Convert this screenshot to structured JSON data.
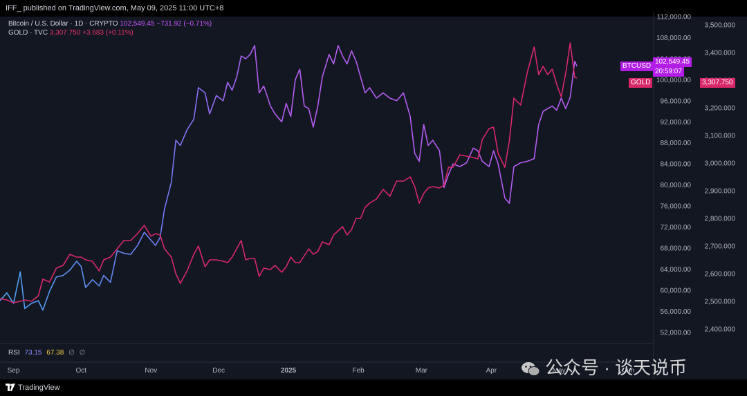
{
  "header": {
    "published": "IFF_ published on TradingView.com, May 09, 2025 11:00 UTC+8"
  },
  "legend": {
    "btc": {
      "name": "Bitcoin / U.S. Dollar · 1D · CRYPTO",
      "price": "102,549.45",
      "change": "−731.92 (−0.71%)"
    },
    "gold": {
      "name": "GOLD · TVC",
      "price": "3,307.750",
      "change": "+3.683 (+0.11%)"
    }
  },
  "tags": {
    "btc_label": "BTCUSD",
    "btc_price": "102,549.45",
    "btc_time": "20:59:07",
    "gold_label": "GOLD",
    "gold_price": "3,307.750"
  },
  "rsi": {
    "label": "RSI",
    "v1": "73.15",
    "v2": "67.38",
    "g1": "∅",
    "g2": "∅"
  },
  "footer": {
    "brand": "TradingView"
  },
  "watermark": {
    "text": "公众号 · 谈天说币"
  },
  "colors": {
    "btc": "#b45cf0",
    "btc_early": "#4aa3f0",
    "gold": "#d8286a",
    "bg": "#131722"
  },
  "chart_data": {
    "type": "line",
    "title": "",
    "x_ticks": [
      "Sep",
      "Oct",
      "Nov",
      "Dec",
      "2025",
      "Feb",
      "Mar",
      "Apr",
      "May",
      "Jun"
    ],
    "left_axis": {
      "series": "BTCUSD",
      "ticks": [
        "112,000.00",
        "108,000.00",
        "104,000.00",
        "100,000.00",
        "96,000.00",
        "92,000.00",
        "88,000.00",
        "84,000.00",
        "80,000.00",
        "76,000.00",
        "72,000.00",
        "68,000.00",
        "64,000.00",
        "60,000.00",
        "56,000.00",
        "52,000.00"
      ],
      "ylim": [
        50000,
        112000
      ]
    },
    "right_axis": {
      "series": "GOLD",
      "ticks": [
        "3,500.000",
        "3,400.000",
        "3,300.000",
        "3,200.000",
        "3,100.000",
        "3,000.000",
        "2,900.000",
        "2,800.000",
        "2,700.000",
        "2,600.000",
        "2,500.000",
        "2,400.000"
      ],
      "ylim": [
        2350,
        3530
      ]
    },
    "series": [
      {
        "name": "BTCUSD",
        "axis": "left",
        "points": [
          [
            "Aug 26",
            58000
          ],
          [
            "Aug 29",
            59500
          ],
          [
            "Sep 1",
            57500
          ],
          [
            "Sep 4",
            63500
          ],
          [
            "Sep 6",
            56500
          ],
          [
            "Sep 9",
            57500
          ],
          [
            "Sep 12",
            58000
          ],
          [
            "Sep 14",
            56200
          ],
          [
            "Sep 17",
            59800
          ],
          [
            "Sep 20",
            62500
          ],
          [
            "Sep 23",
            62800
          ],
          [
            "Sep 26",
            63800
          ],
          [
            "Sep 29",
            65500
          ],
          [
            "Oct 1",
            64500
          ],
          [
            "Oct 3",
            60500
          ],
          [
            "Oct 6",
            62000
          ],
          [
            "Oct 9",
            60800
          ],
          [
            "Oct 11",
            62800
          ],
          [
            "Oct 14",
            61500
          ],
          [
            "Oct 17",
            67500
          ],
          [
            "Oct 20",
            67000
          ],
          [
            "Oct 23",
            66800
          ],
          [
            "Oct 26",
            68500
          ],
          [
            "Oct 29",
            71000
          ],
          [
            "Nov 1",
            69500
          ],
          [
            "Nov 3",
            68500
          ],
          [
            "Nov 5",
            70000
          ],
          [
            "Nov 7",
            75500
          ],
          [
            "Nov 10",
            80500
          ],
          [
            "Nov 12",
            88500
          ],
          [
            "Nov 14",
            87500
          ],
          [
            "Nov 17",
            90500
          ],
          [
            "Nov 20",
            92500
          ],
          [
            "Nov 22",
            98500
          ],
          [
            "Nov 25",
            97500
          ],
          [
            "Nov 27",
            93500
          ],
          [
            "Nov 30",
            97000
          ],
          [
            "Dec 3",
            96000
          ],
          [
            "Dec 5",
            99500
          ],
          [
            "Dec 7",
            98000
          ],
          [
            "Dec 9",
            100500
          ],
          [
            "Dec 11",
            104500
          ],
          [
            "Dec 13",
            104000
          ],
          [
            "Dec 15",
            104800
          ],
          [
            "Dec 17",
            106500
          ],
          [
            "Dec 19",
            97500
          ],
          [
            "Dec 21",
            98800
          ],
          [
            "Dec 24",
            95000
          ],
          [
            "Dec 26",
            93500
          ],
          [
            "Dec 29",
            92000
          ],
          [
            "Dec 31",
            95500
          ],
          [
            "Jan 2",
            93000
          ],
          [
            "Jan 4",
            100000
          ],
          [
            "Jan 6",
            102000
          ],
          [
            "Jan 8",
            95000
          ],
          [
            "Jan 10",
            94500
          ],
          [
            "Jan 12",
            91000
          ],
          [
            "Jan 14",
            95000
          ],
          [
            "Jan 16",
            100500
          ],
          [
            "Jan 19",
            104800
          ],
          [
            "Jan 21",
            103000
          ],
          [
            "Jan 23",
            106500
          ],
          [
            "Jan 25",
            104500
          ],
          [
            "Jan 27",
            103000
          ],
          [
            "Jan 29",
            105500
          ],
          [
            "Jan 31",
            103500
          ],
          [
            "Feb 2",
            100500
          ],
          [
            "Feb 4",
            97500
          ],
          [
            "Feb 6",
            98500
          ],
          [
            "Feb 9",
            96500
          ],
          [
            "Feb 12",
            97500
          ],
          [
            "Feb 15",
            96500
          ],
          [
            "Feb 18",
            96000
          ],
          [
            "Feb 21",
            97500
          ],
          [
            "Feb 24",
            93000
          ],
          [
            "Feb 26",
            86000
          ],
          [
            "Feb 28",
            84500
          ],
          [
            "Mar 2",
            91500
          ],
          [
            "Mar 4",
            87500
          ],
          [
            "Mar 6",
            88500
          ],
          [
            "Mar 9",
            86500
          ],
          [
            "Mar 11",
            79500
          ],
          [
            "Mar 13",
            82000
          ],
          [
            "Mar 15",
            84000
          ],
          [
            "Mar 18",
            83500
          ],
          [
            "Mar 21",
            84200
          ],
          [
            "Mar 24",
            87000
          ],
          [
            "Mar 26",
            86500
          ],
          [
            "Mar 28",
            84500
          ],
          [
            "Mar 31",
            83500
          ],
          [
            "Apr 2",
            86500
          ],
          [
            "Apr 4",
            84000
          ],
          [
            "Apr 7",
            77500
          ],
          [
            "Apr 9",
            76500
          ],
          [
            "Apr 11",
            83500
          ],
          [
            "Apr 14",
            84200
          ],
          [
            "Apr 17",
            84500
          ],
          [
            "Apr 20",
            85000
          ],
          [
            "Apr 22",
            91500
          ],
          [
            "Apr 24",
            94000
          ],
          [
            "Apr 26",
            94500
          ],
          [
            "Apr 28",
            95000
          ],
          [
            "Apr 30",
            94200
          ],
          [
            "May 2",
            96500
          ],
          [
            "May 4",
            94500
          ],
          [
            "May 6",
            96700
          ],
          [
            "May 8",
            103500
          ],
          [
            "May 9",
            102549
          ]
        ]
      },
      {
        "name": "GOLD",
        "axis": "right",
        "points": [
          [
            "Aug 26",
            2510
          ],
          [
            "Aug 29",
            2505
          ],
          [
            "Sep 1",
            2495
          ],
          [
            "Sep 4",
            2500
          ],
          [
            "Sep 6",
            2505
          ],
          [
            "Sep 9",
            2500
          ],
          [
            "Sep 12",
            2520
          ],
          [
            "Sep 14",
            2580
          ],
          [
            "Sep 17",
            2570
          ],
          [
            "Sep 20",
            2620
          ],
          [
            "Sep 23",
            2630
          ],
          [
            "Sep 26",
            2670
          ],
          [
            "Sep 29",
            2660
          ],
          [
            "Oct 1",
            2660
          ],
          [
            "Oct 3",
            2650
          ],
          [
            "Oct 6",
            2645
          ],
          [
            "Oct 9",
            2610
          ],
          [
            "Oct 11",
            2650
          ],
          [
            "Oct 14",
            2660
          ],
          [
            "Oct 17",
            2690
          ],
          [
            "Oct 20",
            2720
          ],
          [
            "Oct 23",
            2720
          ],
          [
            "Oct 26",
            2745
          ],
          [
            "Oct 29",
            2775
          ],
          [
            "Nov 1",
            2735
          ],
          [
            "Nov 3",
            2745
          ],
          [
            "Nov 5",
            2740
          ],
          [
            "Nov 7",
            2690
          ],
          [
            "Nov 10",
            2660
          ],
          [
            "Nov 12",
            2600
          ],
          [
            "Nov 14",
            2565
          ],
          [
            "Nov 17",
            2610
          ],
          [
            "Nov 20",
            2670
          ],
          [
            "Nov 22",
            2700
          ],
          [
            "Nov 25",
            2625
          ],
          [
            "Nov 27",
            2650
          ],
          [
            "Nov 30",
            2650
          ],
          [
            "Dec 3",
            2645
          ],
          [
            "Dec 5",
            2640
          ],
          [
            "Dec 7",
            2660
          ],
          [
            "Dec 9",
            2690
          ],
          [
            "Dec 11",
            2720
          ],
          [
            "Dec 13",
            2650
          ],
          [
            "Dec 15",
            2655
          ],
          [
            "Dec 17",
            2655
          ],
          [
            "Dec 19",
            2590
          ],
          [
            "Dec 21",
            2620
          ],
          [
            "Dec 24",
            2615
          ],
          [
            "Dec 26",
            2630
          ],
          [
            "Dec 29",
            2605
          ],
          [
            "Dec 31",
            2625
          ],
          [
            "Jan 2",
            2660
          ],
          [
            "Jan 4",
            2640
          ],
          [
            "Jan 6",
            2640
          ],
          [
            "Jan 8",
            2665
          ],
          [
            "Jan 10",
            2690
          ],
          [
            "Jan 12",
            2670
          ],
          [
            "Jan 14",
            2680
          ],
          [
            "Jan 16",
            2715
          ],
          [
            "Jan 19",
            2705
          ],
          [
            "Jan 21",
            2740
          ],
          [
            "Jan 23",
            2755
          ],
          [
            "Jan 25",
            2770
          ],
          [
            "Jan 27",
            2740
          ],
          [
            "Jan 29",
            2760
          ],
          [
            "Jan 31",
            2800
          ],
          [
            "Feb 2",
            2800
          ],
          [
            "Feb 4",
            2840
          ],
          [
            "Feb 6",
            2855
          ],
          [
            "Feb 9",
            2870
          ],
          [
            "Feb 12",
            2905
          ],
          [
            "Feb 15",
            2880
          ],
          [
            "Feb 18",
            2935
          ],
          [
            "Feb 21",
            2935
          ],
          [
            "Feb 24",
            2950
          ],
          [
            "Feb 26",
            2915
          ],
          [
            "Feb 28",
            2855
          ],
          [
            "Mar 2",
            2890
          ],
          [
            "Mar 4",
            2910
          ],
          [
            "Mar 6",
            2915
          ],
          [
            "Mar 9",
            2910
          ],
          [
            "Mar 11",
            2920
          ],
          [
            "Mar 13",
            2985
          ],
          [
            "Mar 15",
            2985
          ],
          [
            "Mar 18",
            3030
          ],
          [
            "Mar 21",
            3025
          ],
          [
            "Mar 24",
            3020
          ],
          [
            "Mar 26",
            3015
          ],
          [
            "Mar 28",
            3085
          ],
          [
            "Mar 31",
            3125
          ],
          [
            "Apr 2",
            3130
          ],
          [
            "Apr 4",
            3035
          ],
          [
            "Apr 7",
            2985
          ],
          [
            "Apr 9",
            3080
          ],
          [
            "Apr 11",
            3235
          ],
          [
            "Apr 14",
            3210
          ],
          [
            "Apr 17",
            3330
          ],
          [
            "Apr 20",
            3420
          ],
          [
            "Apr 22",
            3320
          ],
          [
            "Apr 24",
            3350
          ],
          [
            "Apr 26",
            3320
          ],
          [
            "Apr 28",
            3340
          ],
          [
            "Apr 30",
            3285
          ],
          [
            "May 2",
            3240
          ],
          [
            "May 4",
            3325
          ],
          [
            "May 6",
            3435
          ],
          [
            "May 8",
            3310
          ],
          [
            "May 9",
            3307.75
          ]
        ]
      }
    ]
  }
}
